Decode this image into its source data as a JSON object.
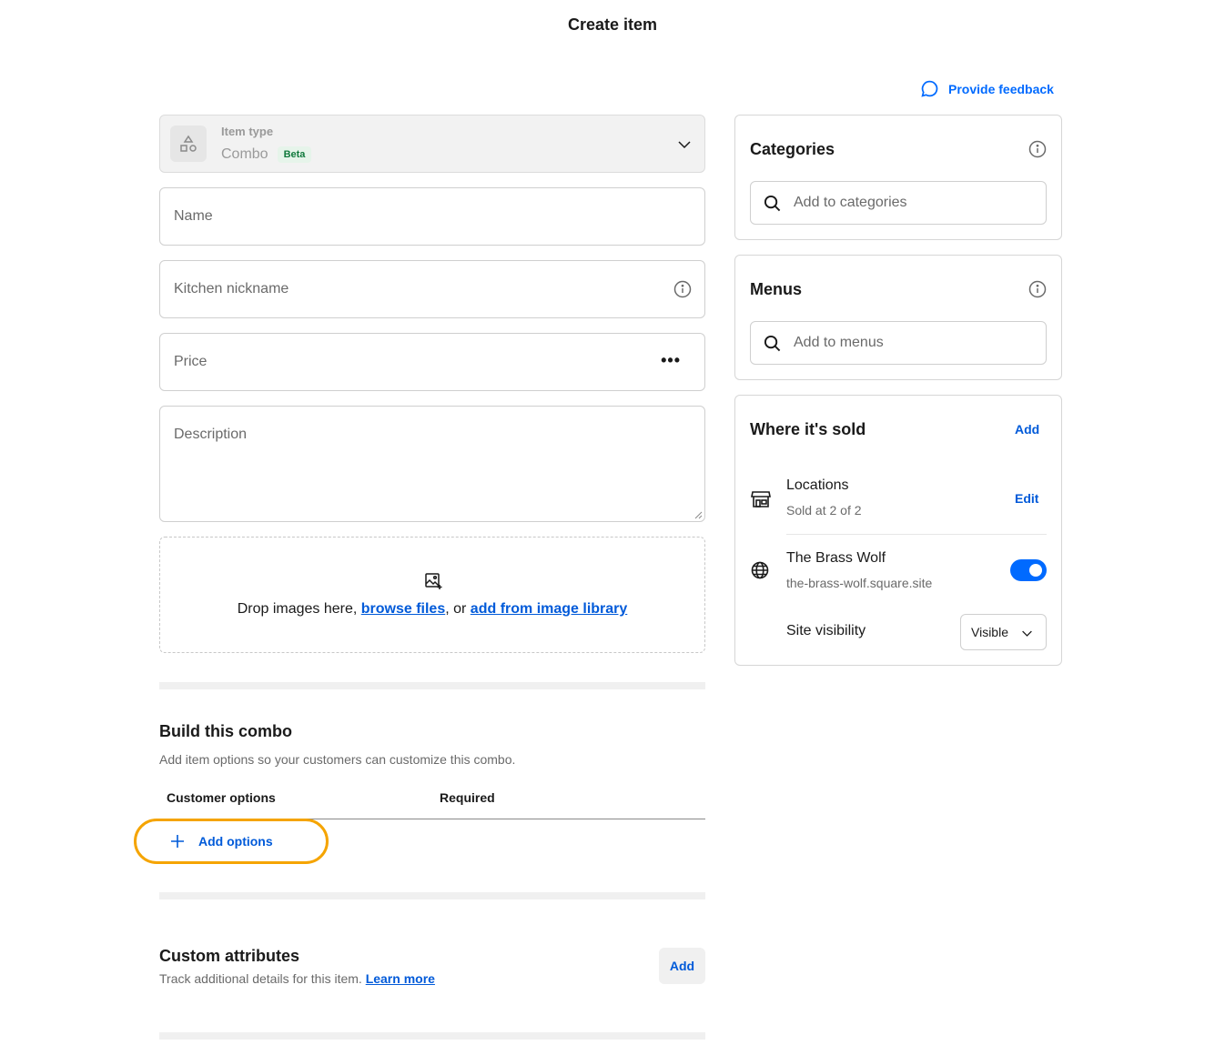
{
  "page": {
    "title": "Create item"
  },
  "feedback": {
    "label": "Provide feedback"
  },
  "item_type": {
    "label": "Item type",
    "value": "Combo",
    "badge": "Beta"
  },
  "fields": {
    "name_placeholder": "Name",
    "kitchen_placeholder": "Kitchen nickname",
    "price_placeholder": "Price",
    "description_placeholder": "Description"
  },
  "dropzone": {
    "prefix": "Drop images here, ",
    "browse": "browse files",
    "middle": ", or ",
    "library": "add from image library"
  },
  "combo": {
    "title": "Build this combo",
    "subtitle": "Add item options so your customers can customize this combo.",
    "col_options": "Customer options",
    "col_required": "Required",
    "add_options": "Add options"
  },
  "attributes": {
    "title": "Custom attributes",
    "subtitle": "Track additional details for this item.",
    "learn_more": "Learn more",
    "add": "Add"
  },
  "categories": {
    "title": "Categories",
    "placeholder": "Add to categories"
  },
  "menus": {
    "title": "Menus",
    "placeholder": "Add to menus"
  },
  "where_sold": {
    "title": "Where it's sold",
    "add": "Add",
    "locations_title": "Locations",
    "locations_sub": "Sold at 2 of 2",
    "edit": "Edit",
    "site_name": "The Brass Wolf",
    "site_url": "the-brass-wolf.square.site",
    "site_enabled": true,
    "visibility_label": "Site visibility",
    "visibility_value": "Visible"
  },
  "colors": {
    "accent": "#006aff",
    "highlight": "#f5a400",
    "link": "#005ad9"
  }
}
